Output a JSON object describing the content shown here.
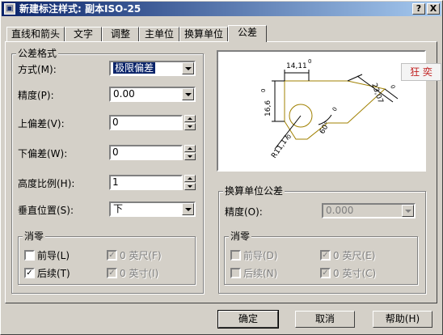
{
  "window": {
    "title": "新建标注样式: 副本ISO-25",
    "help_btn": "?",
    "close_btn": "X",
    "app_icon": "dialog-icon"
  },
  "tabs": [
    "直线和箭头",
    "文字",
    "调整",
    "主单位",
    "换算单位",
    "公差"
  ],
  "active_tab": "公差",
  "tolerance_format": {
    "title": "公差格式",
    "method_label": "方式(M):",
    "method_value": "极限偏差",
    "precision_label": "精度(P):",
    "precision_value": "0.00",
    "upper_label": "上偏差(V):",
    "upper_value": "0",
    "lower_label": "下偏差(W):",
    "lower_value": "0",
    "height_label": "高度比例(H):",
    "height_value": "1",
    "vpos_label": "垂直位置(S):",
    "vpos_value": "下"
  },
  "zero_suppress": {
    "title": "消零",
    "leading": "前导(L)",
    "leading_checked": false,
    "trailing": "后续(T)",
    "trailing_checked": true,
    "feet": "0 英尺(F)",
    "feet_checked": true,
    "inches": "0 英寸(I)",
    "inches_checked": true
  },
  "preview": {
    "dim_top": "14,11",
    "dim_top_tol": "0",
    "dim_left": "16,6",
    "dim_left_tol": "0",
    "dim_right": "23,07",
    "dim_right_tol": "0",
    "dim_angle": "60°",
    "dim_angle_tol": "0",
    "dim_radius": "R11,17",
    "dim_radius_tol": "0",
    "line_color": "#a08000"
  },
  "alt_unit_tol": {
    "title": "换算单位公差",
    "precision_label": "精度(O):",
    "precision_value": "0.000"
  },
  "alt_zero_suppress": {
    "title": "消零",
    "leading": "前导(D)",
    "trailing": "后续(N)",
    "feet": "0 英尺(E)",
    "inches": "0 英寸(C)",
    "feet_checked": true,
    "inches_checked": true
  },
  "buttons": {
    "ok": "确定",
    "cancel": "取消",
    "help": "帮助(H)"
  },
  "floating_logo": "狂 奕"
}
